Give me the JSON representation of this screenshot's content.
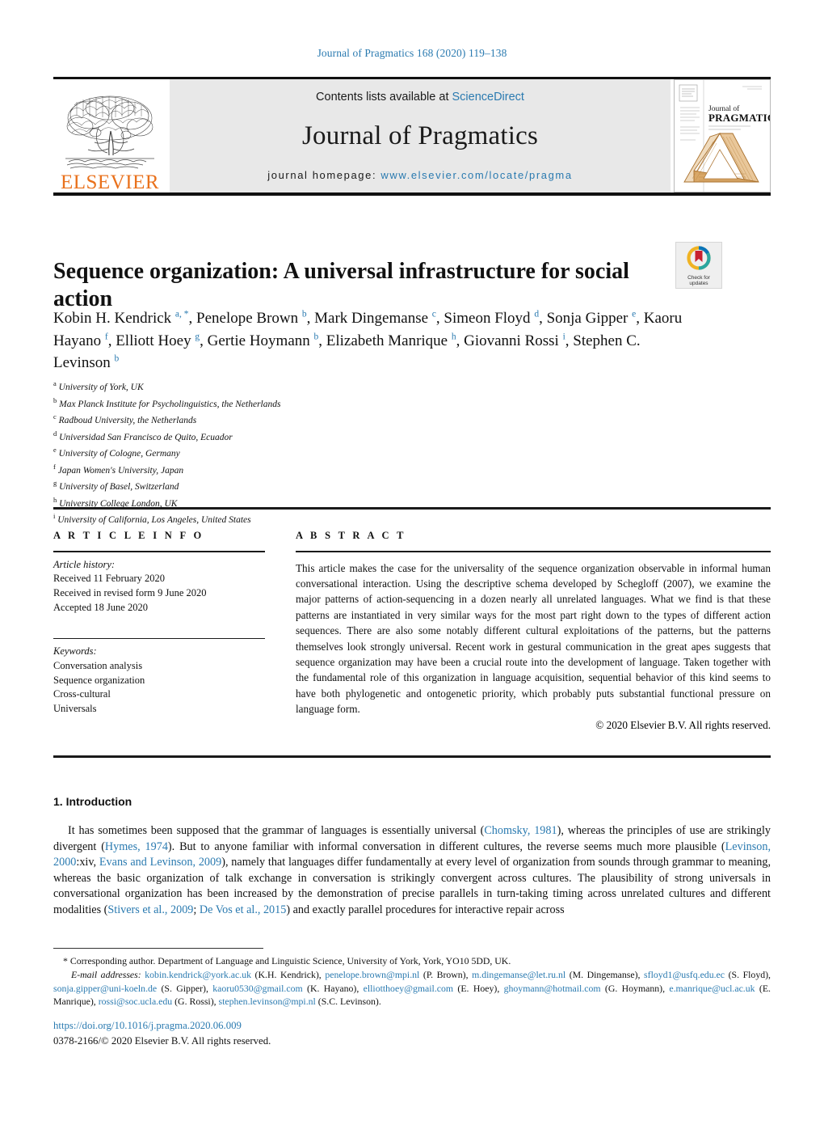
{
  "running_head": "Journal of Pragmatics 168 (2020) 119–138",
  "masthead": {
    "contents_prefix": "Contents lists available at ",
    "sciencedirect": "ScienceDirect",
    "journal_name": "Journal of Pragmatics",
    "homepage_prefix": "journal homepage: ",
    "homepage_url": "www.elsevier.com/locate/pragma",
    "publisher": "ELSEVIER",
    "cover_title_line1": "Journal of",
    "cover_title_line2": "PRAGMATICS",
    "accent_orange": "#e9711c",
    "link_blue": "#2a7ab0"
  },
  "crossmark": {
    "line1": "Check for",
    "line2": "updates"
  },
  "article": {
    "title": "Sequence organization: A universal infrastructure for social action",
    "authors": [
      {
        "name": "Kobin H. Kendrick",
        "marks": "a, *"
      },
      {
        "name": "Penelope Brown",
        "marks": "b"
      },
      {
        "name": "Mark Dingemanse",
        "marks": "c"
      },
      {
        "name": "Simeon Floyd",
        "marks": "d"
      },
      {
        "name": "Sonja Gipper",
        "marks": "e"
      },
      {
        "name": "Kaoru Hayano",
        "marks": "f"
      },
      {
        "name": "Elliott Hoey",
        "marks": "g"
      },
      {
        "name": "Gertie Hoymann",
        "marks": "b"
      },
      {
        "name": "Elizabeth Manrique",
        "marks": "h"
      },
      {
        "name": "Giovanni Rossi",
        "marks": "i"
      },
      {
        "name": "Stephen C. Levinson",
        "marks": "b"
      }
    ],
    "affiliations": [
      {
        "mark": "a",
        "text": "University of York, UK"
      },
      {
        "mark": "b",
        "text": "Max Planck Institute for Psycholinguistics, the Netherlands"
      },
      {
        "mark": "c",
        "text": "Radboud University, the Netherlands"
      },
      {
        "mark": "d",
        "text": "Universidad San Francisco de Quito, Ecuador"
      },
      {
        "mark": "e",
        "text": "University of Cologne, Germany"
      },
      {
        "mark": "f",
        "text": "Japan Women's University, Japan"
      },
      {
        "mark": "g",
        "text": "University of Basel, Switzerland"
      },
      {
        "mark": "h",
        "text": "University College London, UK"
      },
      {
        "mark": "i",
        "text": "University of California, Los Angeles, United States"
      }
    ]
  },
  "article_info": {
    "heading": "A R T I C L E    I N F O",
    "history_label": "Article history:",
    "history": [
      "Received 11 February 2020",
      "Received in revised form 9 June 2020",
      "Accepted 18 June 2020"
    ],
    "keywords_label": "Keywords:",
    "keywords": [
      "Conversation analysis",
      "Sequence organization",
      "Cross-cultural",
      "Universals"
    ]
  },
  "abstract": {
    "heading": "A B S T R A C T",
    "text": "This article makes the case for the universality of the sequence organization observable in informal human conversational interaction. Using the descriptive schema developed by Schegloff (2007), we examine the major patterns of action-sequencing in a dozen nearly all unrelated languages. What we find is that these patterns are instantiated in very similar ways for the most part right down to the types of different action sequences. There are also some notably different cultural exploitations of the patterns, but the patterns themselves look strongly universal. Recent work in gestural communication in the great apes suggests that sequence organization may have been a crucial route into the development of language. Taken together with the fundamental role of this organization in language acquisition, sequential behavior of this kind seems to have both phylogenetic and ontogenetic priority, which probably puts substantial functional pressure on language form.",
    "copyright": "© 2020 Elsevier B.V. All rights reserved."
  },
  "introduction": {
    "heading": "1.  Introduction",
    "paragraph_parts": [
      {
        "t": "It has sometimes been supposed that the grammar of languages is essentially universal (",
        "link": false
      },
      {
        "t": "Chomsky, 1981",
        "link": true
      },
      {
        "t": "), whereas the principles of use are strikingly divergent (",
        "link": false
      },
      {
        "t": "Hymes, 1974",
        "link": true
      },
      {
        "t": "). But to anyone familiar with informal conversation in different cultures, the reverse seems much more plausible (",
        "link": false
      },
      {
        "t": "Levinson, 2000",
        "link": true
      },
      {
        "t": ":xiv, ",
        "link": false
      },
      {
        "t": "Evans and Levinson, 2009",
        "link": true
      },
      {
        "t": "), namely that languages differ fundamentally at every level of organization from sounds through grammar to meaning, whereas the basic organization of talk exchange in conversation is strikingly convergent across cultures. The plausibility of strong universals in conversational organization has been increased by the demonstration of precise parallels in turn-taking timing across unrelated cultures and different modalities (",
        "link": false
      },
      {
        "t": "Stivers et al., 2009",
        "link": true
      },
      {
        "t": "; ",
        "link": false
      },
      {
        "t": "De Vos et al., 2015",
        "link": true
      },
      {
        "t": ") and exactly parallel procedures for interactive repair across",
        "link": false
      }
    ]
  },
  "footnote": {
    "corresponding": "*  Corresponding author. Department of Language and Linguistic Science, University of York, York, YO10 5DD, UK.",
    "email_label": "E-mail addresses:",
    "emails": [
      {
        "address": "kobin.kendrick@york.ac.uk",
        "person": "(K.H. Kendrick)"
      },
      {
        "address": "penelope.brown@mpi.nl",
        "person": "(P. Brown)"
      },
      {
        "address": "m.dingemanse@let.ru.nl",
        "person": "(M. Dingemanse)"
      },
      {
        "address": "sfloyd1@usfq.edu.ec",
        "person": "(S. Floyd)"
      },
      {
        "address": "sonja.gipper@uni-koeln.de",
        "person": "(S. Gipper)"
      },
      {
        "address": "kaoru0530@gmail.com",
        "person": "(K. Hayano)"
      },
      {
        "address": "elliotthoey@gmail.com",
        "person": "(E. Hoey)"
      },
      {
        "address": "ghoymann@hotmail.com",
        "person": "(G. Hoymann)"
      },
      {
        "address": "e.manrique@ucl.ac.uk",
        "person": "(E. Manrique)"
      },
      {
        "address": "rossi@soc.ucla.edu",
        "person": "(G. Rossi)"
      },
      {
        "address": "stephen.levinson@mpi.nl",
        "person": "(S.C. Levinson)"
      }
    ]
  },
  "bottom": {
    "doi": "https://doi.org/10.1016/j.pragma.2020.06.009",
    "issn_line": "0378-2166/© 2020 Elsevier B.V. All rights reserved."
  }
}
